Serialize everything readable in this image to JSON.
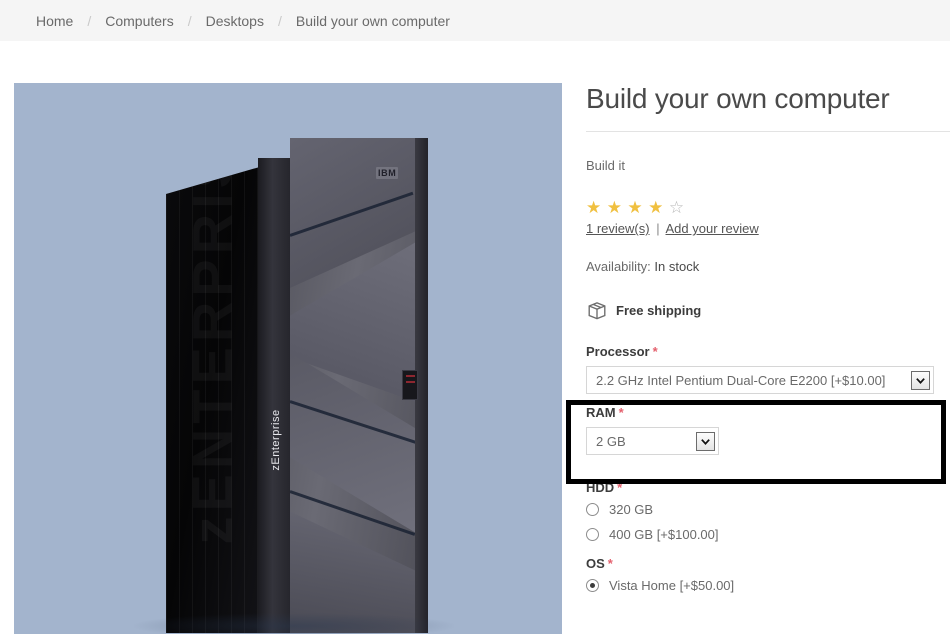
{
  "breadcrumb": {
    "separator": "/",
    "items": [
      {
        "label": "Home",
        "current": false
      },
      {
        "label": "Computers",
        "current": false
      },
      {
        "label": "Desktops",
        "current": false
      },
      {
        "label": "Build your own computer",
        "current": true
      }
    ]
  },
  "product": {
    "title": "Build your own computer",
    "short_description": "Build it",
    "image_alt": "IBM zEnterprise server tower",
    "image_brand": "IBM",
    "image_model": "zEnterprise",
    "image_watermark": "zENTERPRISE",
    "background_color": "#a3b4cd"
  },
  "rating": {
    "value": 4,
    "max": 5,
    "star_on_color": "#f0c040",
    "star_off_color": "#b9b9b9",
    "reviews_link": "1 review(s)",
    "separator": "|",
    "add_review_link": "Add your review"
  },
  "availability": {
    "label": "Availability:",
    "value": "In stock"
  },
  "shipping": {
    "icon": "package-box-icon",
    "label": "Free shipping"
  },
  "attributes": {
    "required_marker": "*",
    "processor": {
      "label": "Processor",
      "control": "dropdown",
      "selected": "2.2 GHz Intel Pentium Dual-Core E2200 [+$10.00]",
      "highlighted": true,
      "highlight_color": "#000000"
    },
    "ram": {
      "label": "RAM",
      "control": "dropdown",
      "selected": "2 GB"
    },
    "hdd": {
      "label": "HDD",
      "control": "radio",
      "options": [
        {
          "label": "320 GB",
          "selected": false
        },
        {
          "label": "400 GB [+$100.00]",
          "selected": false
        }
      ]
    },
    "os": {
      "label": "OS",
      "control": "radio",
      "options": [
        {
          "label": "Vista Home [+$50.00]",
          "selected": true
        }
      ]
    }
  }
}
